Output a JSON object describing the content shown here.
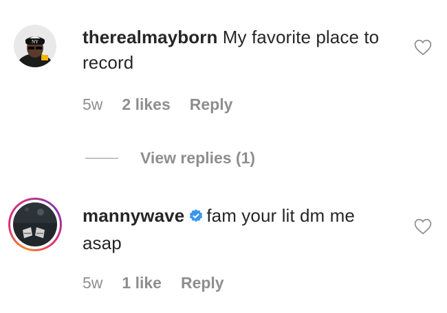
{
  "comments": [
    {
      "username": "therealmayborn",
      "text": "My favorite place to record",
      "time": "5w",
      "likes": "2 likes",
      "reply": "Reply",
      "verified": false,
      "avatar_icon": "user-avatar-photo",
      "heart_icon": "heart-outline-icon"
    },
    {
      "username": "mannywave",
      "text": "fam your lit dm me asap",
      "time": "5w",
      "likes": "1 like",
      "reply": "Reply",
      "verified": true,
      "avatar_icon": "story-ring-avatar-photo",
      "heart_icon": "heart-outline-icon"
    }
  ],
  "view_replies": "View replies (1)",
  "colors": {
    "text": "#262626",
    "muted": "#8e8e8e",
    "verified": "#3897f0"
  }
}
